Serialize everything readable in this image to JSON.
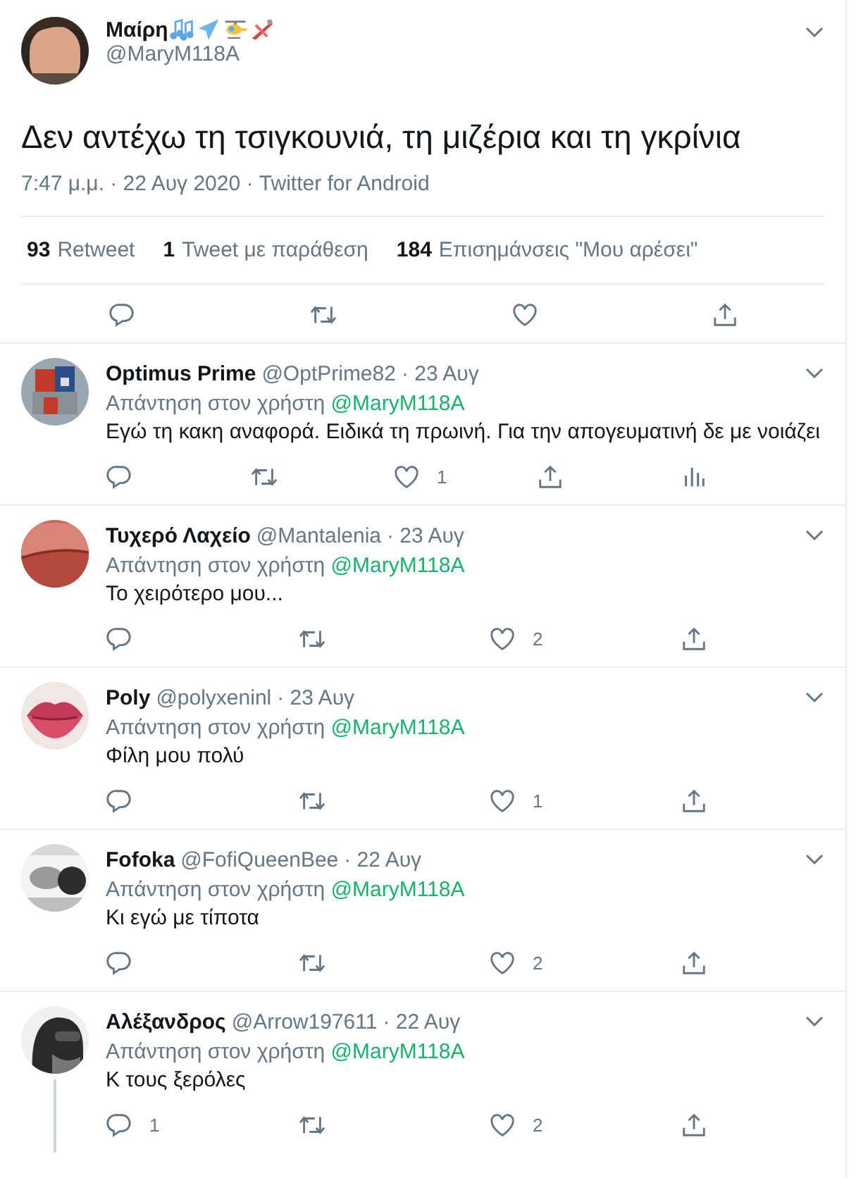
{
  "tweet": {
    "author": {
      "name": "Μαίρη",
      "handle": "@MaryM118A"
    },
    "text": "Δεν αντέχω τη τσιγκουνιά, τη μιζέρια και τη γκρίνια",
    "meta": "7:47 μ.μ. · 22 Αυγ 2020 · Twitter for Android",
    "stats": [
      {
        "count": "93",
        "label": "Retweet"
      },
      {
        "count": "1",
        "label": "Tweet με παράθεση"
      },
      {
        "count": "184",
        "label": "Επισημάνσεις \"Μου αρέσει\""
      }
    ],
    "actions": [
      {
        "kind": "reply"
      },
      {
        "kind": "retweet"
      },
      {
        "kind": "like"
      },
      {
        "kind": "share"
      }
    ]
  },
  "replies": [
    {
      "name": "Optimus Prime",
      "handle": "@OptPrime82",
      "date": "· 23 Αυγ",
      "reply_to": "Απάντηση στον χρήστη",
      "mention": "@MaryM118A",
      "text": "Εγώ τη κακη αναφορά. Ειδικά τη πρωινή. Για την απογευματινή δε με νοιάζει",
      "thread_line": false,
      "actions": [
        {
          "kind": "reply"
        },
        {
          "kind": "retweet"
        },
        {
          "kind": "like",
          "count": "1"
        },
        {
          "kind": "share"
        },
        {
          "kind": "analytics"
        }
      ]
    },
    {
      "name": "Τυχερό Λαχείο",
      "handle": "@Mantalenia",
      "date": "· 23 Αυγ",
      "reply_to": "Απάντηση στον χρήστη",
      "mention": "@MaryM118A",
      "text": "Το χειρότερο μου...",
      "thread_line": false,
      "actions": [
        {
          "kind": "reply"
        },
        {
          "kind": "retweet"
        },
        {
          "kind": "like",
          "count": "2"
        },
        {
          "kind": "share"
        }
      ]
    },
    {
      "name": "Poly",
      "handle": "@polyxeninl",
      "date": "· 23 Αυγ",
      "reply_to": "Απάντηση στον χρήστη",
      "mention": "@MaryM118A",
      "text": "Φίλη μου πολύ",
      "thread_line": false,
      "actions": [
        {
          "kind": "reply"
        },
        {
          "kind": "retweet"
        },
        {
          "kind": "like",
          "count": "1"
        },
        {
          "kind": "share"
        }
      ]
    },
    {
      "name": "Fofoka",
      "handle": "@FofiQueenBee",
      "date": "· 22 Αυγ",
      "reply_to": "Απάντηση στον χρήστη",
      "mention": "@MaryM118A",
      "text": "Κι εγώ με τίποτα",
      "thread_line": false,
      "actions": [
        {
          "kind": "reply"
        },
        {
          "kind": "retweet"
        },
        {
          "kind": "like",
          "count": "2"
        },
        {
          "kind": "share"
        }
      ]
    },
    {
      "name": "Αλέξανδρος",
      "handle": "@Arrow197611",
      "date": "· 22 Αυγ",
      "reply_to": "Απάντηση στον χρήστη",
      "mention": "@MaryM118A",
      "text": "Κ τους ξερόλες",
      "thread_line": true,
      "actions": [
        {
          "kind": "reply",
          "count": "1"
        },
        {
          "kind": "retweet"
        },
        {
          "kind": "like",
          "count": "2"
        },
        {
          "kind": "share"
        }
      ]
    }
  ]
}
